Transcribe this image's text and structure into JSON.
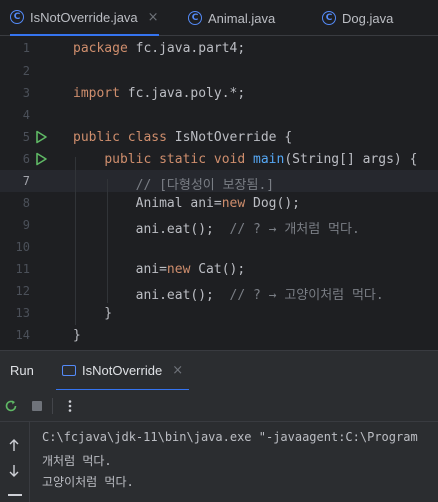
{
  "tabs": [
    {
      "label": "IsNotOverride.java",
      "close": "×",
      "icon": "C"
    },
    {
      "label": "Animal.java",
      "icon": "C"
    },
    {
      "label": "Dog.java",
      "icon": "C"
    }
  ],
  "editor": {
    "line_numbers": [
      "1",
      "2",
      "3",
      "4",
      "5",
      "6",
      "7",
      "8",
      "9",
      "10",
      "11",
      "12",
      "13",
      "14"
    ],
    "current_line": "7"
  },
  "run_panel": {
    "title": "Run",
    "tab_label": "IsNotOverride",
    "tab_close": "×",
    "output": [
      "C:\\fcjava\\jdk-11\\bin\\java.exe \"-javaagent:C:\\Program",
      "개처럼 먹다.",
      "고양이처럼 먹다."
    ]
  },
  "icons": {
    "class": "class-c-icon",
    "run": "run-triangle-icon",
    "rerun": "rerun-icon",
    "stop": "stop-icon",
    "more": "more-vertical-icon",
    "up": "arrow-up-icon",
    "down": "arrow-down-icon"
  },
  "colors": {
    "keyword": "#cf8e6d",
    "function": "#56a8f5",
    "comment": "#7a7e85",
    "accent": "#3574f0",
    "run_green": "#5fb865"
  }
}
